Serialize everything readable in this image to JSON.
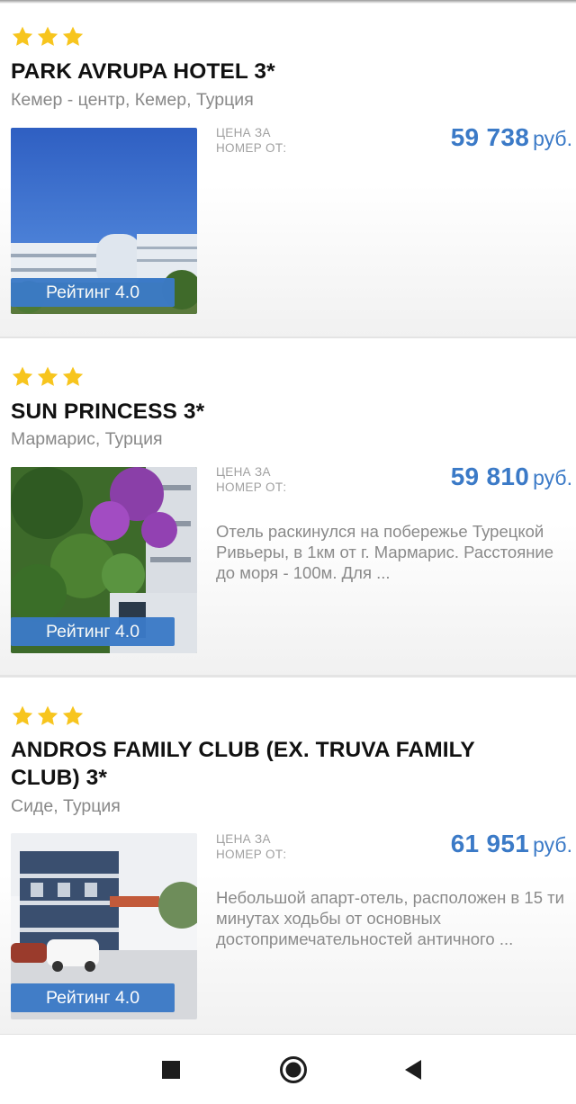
{
  "colors": {
    "accent": "#3b7ac7",
    "star": "#f7c51e",
    "muted_text": "#888888"
  },
  "hotels": [
    {
      "stars": 3,
      "name": "PARK AVRUPA HOTEL 3*",
      "location": "Кемер - центр, Кемер, Турция",
      "rating_label": "Рейтинг 4.0",
      "price_label": "ЦЕНА ЗА НОМЕР ОТ:",
      "price": "59 738",
      "currency": "руб.",
      "description": ""
    },
    {
      "stars": 3,
      "name": "SUN PRINCESS 3*",
      "location": "Мармарис, Турция",
      "rating_label": "Рейтинг 4.0",
      "price_label": "ЦЕНА ЗА НОМЕР ОТ:",
      "price": "59 810",
      "currency": "руб.",
      "description": "Отель раскинулся на побережье Турецкой Ривьеры, в 1км от г. Мармарис. Расстояние до моря - 100м. Для ..."
    },
    {
      "stars": 3,
      "name": "ANDROS FAMILY CLUB (EX. TRUVA FAMILY CLUB) 3*",
      "location": "Сиде, Турция",
      "rating_label": "Рейтинг 4.0",
      "price_label": "ЦЕНА ЗА НОМЕР ОТ:",
      "price": "61 951",
      "currency": "руб.",
      "description": "Небольшой апарт-отель, расположен в 15 ти минутах ходьбы от основных достопримечательностей античного ..."
    }
  ],
  "navbar": {
    "icons": [
      "square-recents-icon",
      "circle-home-icon",
      "triangle-back-icon"
    ]
  }
}
